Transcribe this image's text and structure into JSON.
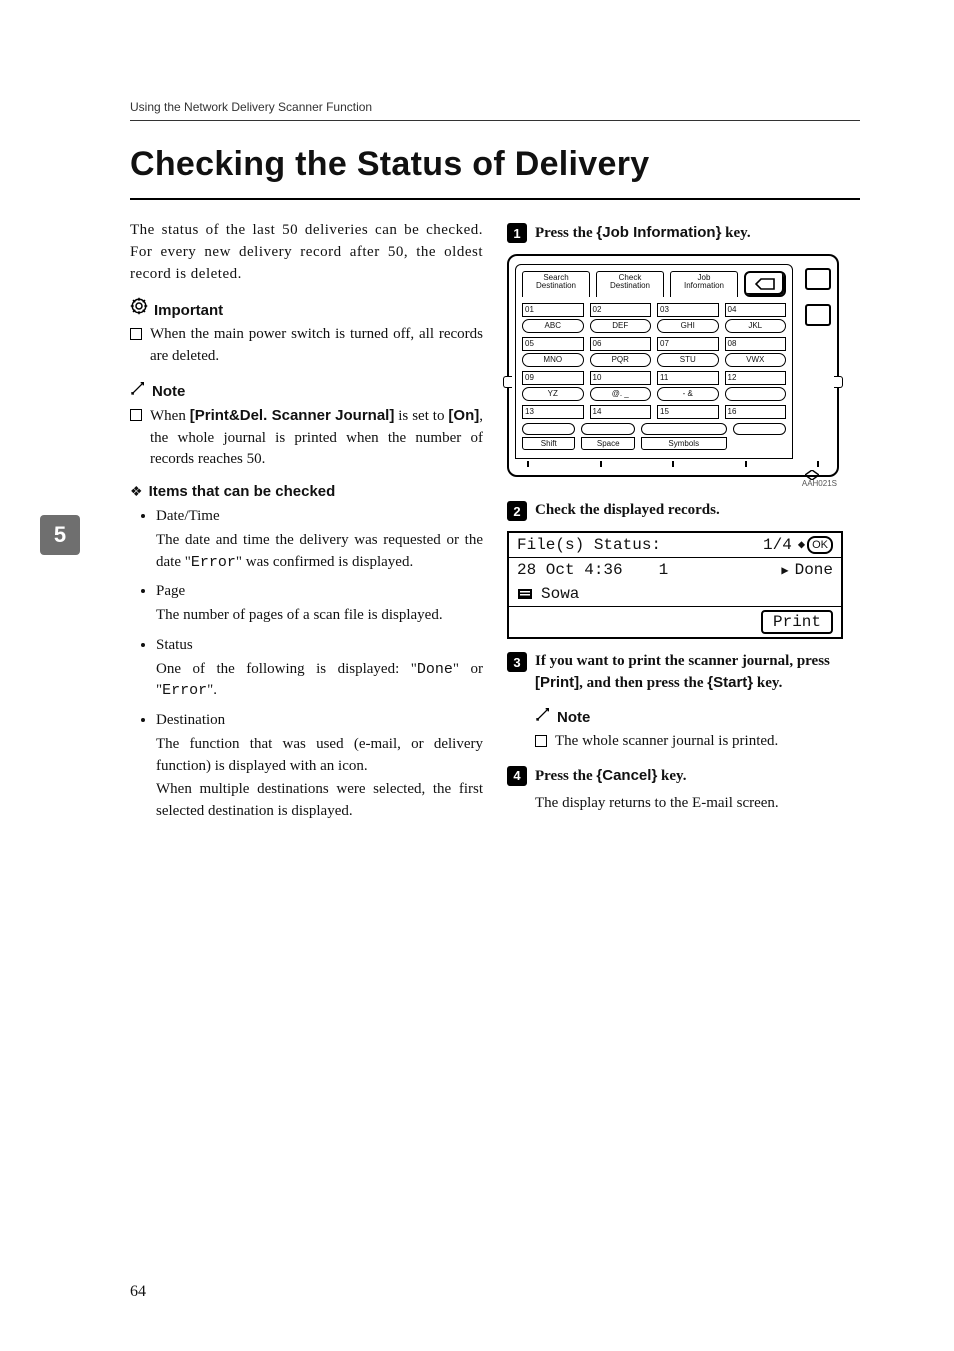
{
  "running_head": "Using the Network Delivery Scanner Function",
  "title": "Checking the Status of Delivery",
  "side_tab": "5",
  "page_number": "64",
  "left": {
    "intro": "The status of the last 50 deliveries can be checked. For every new delivery record after 50, the oldest record is deleted.",
    "important_label": "Important",
    "important_items": [
      {
        "text": "When the main power switch is turned off, all records are deleted."
      }
    ],
    "note_label": "Note",
    "note_items": [
      {
        "pre": "When ",
        "ui1": "[Print&Del. Scanner Journal]",
        "mid": " is set to ",
        "ui2": "[On]",
        "post": ", the whole journal is printed when the number of records reaches 50."
      }
    ],
    "items_label": "Items that can be checked",
    "bullets": [
      {
        "head": "Date/Time",
        "line1_pre": "The date and time the delivery was requested or the date \"",
        "code": "Error",
        "line1_post": "\" was confirmed is displayed."
      },
      {
        "head": "Page",
        "text": "The number of pages of a scan file is displayed."
      },
      {
        "head": "Status",
        "pre": "One of the following is displayed: \"",
        "code1": "Done",
        "mid": "\" or \"",
        "code2": "Error",
        "post": "\"."
      },
      {
        "head": "Destination",
        "text1": "The function that was used (e-mail, or delivery function) is displayed with an icon.",
        "text2": "When multiple destinations were selected, the first selected destination is displayed."
      }
    ]
  },
  "right": {
    "steps": {
      "s1": {
        "num": "1",
        "pre": "Press the ",
        "key": "Job Information",
        "post": " key."
      },
      "s2": {
        "num": "2",
        "text": "Check the displayed records."
      },
      "s3": {
        "num": "3",
        "pre": "If you want to print the scanner journal, press ",
        "ui": "[Print]",
        "mid": ", and then press the ",
        "key": "Start",
        "post": " key."
      },
      "s4": {
        "num": "4",
        "pre": "Press the ",
        "key": "Cancel",
        "post": " key."
      }
    },
    "note_label": "Note",
    "note_text": "The whole scanner journal is printed.",
    "after4": "The display returns to the E-mail screen.",
    "device": {
      "tabs": {
        "t1": "Search\nDestination",
        "t2": "Check\nDestination",
        "t3": "Job\nInformation"
      },
      "rows": [
        [
          "01",
          "02",
          "03",
          "04"
        ],
        [
          "ABC",
          "DEF",
          "GHI",
          "JKL"
        ],
        [
          "05",
          "06",
          "07",
          "08"
        ],
        [
          "MNO",
          "PQR",
          "STU",
          "VWX"
        ],
        [
          "09",
          "10",
          "11",
          "12"
        ],
        [
          "YZ",
          "@. _",
          "- &",
          ""
        ],
        [
          "13",
          "14",
          "15",
          "16"
        ]
      ],
      "specials": {
        "shift": "Shift",
        "space": "Space",
        "symbols": "Symbols"
      },
      "code": "AAH021S"
    },
    "lcd": {
      "status_label": "File(s) Status:",
      "page": "1/4",
      "ok": "OK",
      "date": "28 Oct 4:36",
      "count": "1",
      "done": "Done",
      "dest": "Sowa",
      "print": "Print"
    }
  }
}
